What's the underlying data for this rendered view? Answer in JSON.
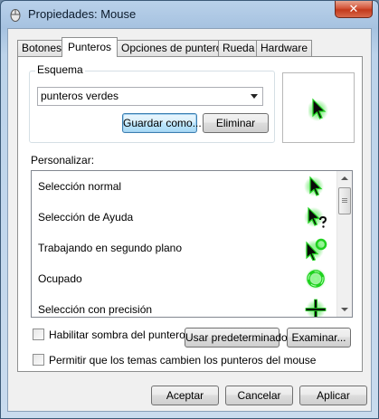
{
  "window": {
    "title": "Propiedades: Mouse",
    "close_glyph": "✕"
  },
  "tabs": [
    {
      "label": "Botones",
      "active": false
    },
    {
      "label": "Punteros",
      "active": true
    },
    {
      "label": "Opciones de puntero",
      "active": false
    },
    {
      "label": "Rueda",
      "active": false
    },
    {
      "label": "Hardware",
      "active": false
    }
  ],
  "scheme": {
    "legend": "Esquema",
    "selected": "punteros verdes",
    "save_as": "Guardar como...",
    "delete": "Eliminar"
  },
  "customize": {
    "label": "Personalizar:",
    "items": [
      {
        "label": "Selección normal",
        "icon": "green-arrow-cursor-icon"
      },
      {
        "label": "Selección de Ayuda",
        "icon": "green-help-cursor-icon"
      },
      {
        "label": "Trabajando en segundo plano",
        "icon": "green-working-cursor-icon"
      },
      {
        "label": "Ocupado",
        "icon": "green-busy-cursor-icon"
      },
      {
        "label": "Selección con precisión",
        "icon": "green-crosshair-cursor-icon"
      }
    ]
  },
  "options": {
    "enable_shadow": "Habilitar sombra del puntero",
    "use_default": "Usar predeterminado",
    "browse": "Examinar...",
    "allow_themes": "Permitir que los temas cambien los punteros del mouse"
  },
  "footer": {
    "ok": "Aceptar",
    "cancel": "Cancelar",
    "apply": "Aplicar"
  },
  "colors": {
    "cursor_green": "#1fd21f",
    "cursor_glow": "#7dff7d"
  }
}
